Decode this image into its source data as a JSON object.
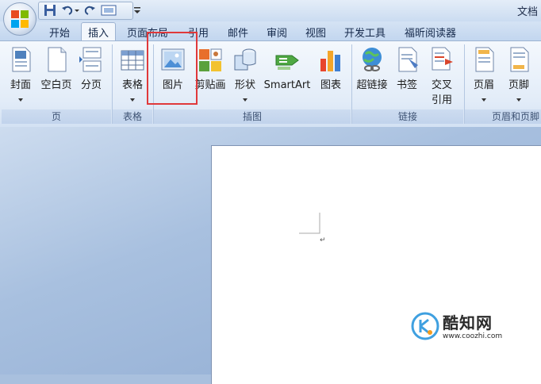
{
  "window": {
    "title": "文档"
  },
  "tabs": [
    "开始",
    "插入",
    "页面布局",
    "引用",
    "邮件",
    "审阅",
    "视图",
    "开发工具",
    "福昕阅读器"
  ],
  "active_tab": "插入",
  "ribbon": {
    "groups": {
      "pages": "页",
      "tables": "表格",
      "illustrations": "插图",
      "links": "链接",
      "header_footer": "页眉和页脚"
    },
    "buttons": {
      "cover": "封面",
      "blank_page": "空白页",
      "page_break": "分页",
      "table": "表格",
      "picture": "图片",
      "clipart": "剪贴画",
      "shapes": "形状",
      "smartart": "SmartArt",
      "chart": "图表",
      "hyperlink": "超链接",
      "bookmark": "书签",
      "cross_ref_1": "交叉",
      "cross_ref_2": "引用",
      "header": "页眉",
      "footer": "页脚"
    }
  },
  "document": {
    "paragraph_mark": "↵"
  },
  "watermark": {
    "brand": "酷知网",
    "url": "www.coozhi.com"
  },
  "colors": {
    "highlight": "#e0393b",
    "accent": "#2b6cb0"
  }
}
